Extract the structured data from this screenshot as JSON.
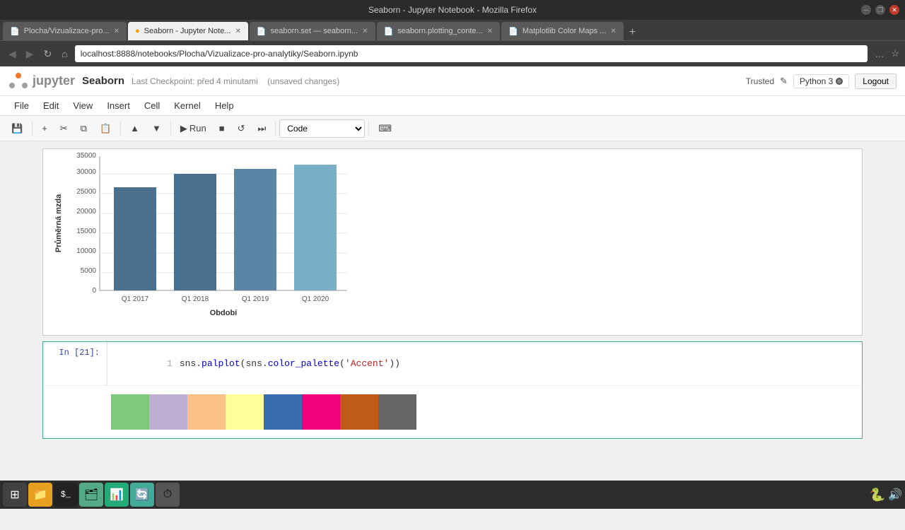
{
  "window": {
    "title": "Seaborn - Jupyter Notebook - Mozilla Firefox",
    "controls": [
      "minimize",
      "restore",
      "close"
    ]
  },
  "browser": {
    "nav_back": "◀",
    "nav_forward": "▶",
    "nav_refresh": "↻",
    "nav_home": "⌂",
    "address": "localhost:8888/notebooks/Plocha/Vizualizace-pro-analytiky/Seaborn.ipynb",
    "extra_btn": "…",
    "bookmark_icon": "☆"
  },
  "tabs": [
    {
      "label": "Plocha/Vizualizace-pro...",
      "active": false,
      "favicon": "📄"
    },
    {
      "label": "Seaborn - Jupyter Note...",
      "active": true,
      "favicon": "🟠"
    },
    {
      "label": "seaborn.set — seaborn...",
      "active": false,
      "favicon": "📄"
    },
    {
      "label": "seaborn.plotting_conte...",
      "active": false,
      "favicon": "📄"
    },
    {
      "label": "Matplotlib Color Maps ...",
      "active": false,
      "favicon": "📄"
    }
  ],
  "jupyter": {
    "logo_text": "jupyter",
    "notebook_title": "Seaborn",
    "checkpoint_text": "Last Checkpoint: před 4 minutami",
    "unsaved": "(unsaved changes)",
    "trusted": "Trusted",
    "edit_icon": "✎",
    "kernel": "Python 3",
    "logout": "Logout"
  },
  "menu": {
    "items": [
      "File",
      "Edit",
      "View",
      "Insert",
      "Cell",
      "Kernel",
      "Help"
    ]
  },
  "toolbar": {
    "save": "💾",
    "add": "+",
    "cut": "✂",
    "copy": "⧉",
    "paste": "📋",
    "move_up": "▲",
    "move_down": "▼",
    "run": "▶ Run",
    "stop": "■",
    "restart": "↺",
    "restart_run": "⏭",
    "cell_type": "Code",
    "keyboard": "⌨"
  },
  "chart": {
    "y_label": "Průměrná mzda",
    "x_label": "Období",
    "x_ticks": [
      "Q1 2017",
      "Q1 2018",
      "Q1 2019",
      "Q1 2020"
    ],
    "y_ticks": [
      "0",
      "5000",
      "10000",
      "15000",
      "20000",
      "25000",
      "30000",
      "35000"
    ],
    "bars": [
      {
        "label": "Q1 2017",
        "value": 27000,
        "color": "#4a7090"
      },
      {
        "label": "Q1 2018",
        "value": 30500,
        "color": "#4a7090"
      },
      {
        "label": "Q1 2019",
        "value": 31800,
        "color": "#5a85a5"
      },
      {
        "label": "Q1 2020",
        "value": 33000,
        "color": "#7aafc8"
      }
    ]
  },
  "code_cell": {
    "in_label": "In [21]:",
    "line_num": "1",
    "code_text": "sns.palplot(sns.color_palette('Accent'))",
    "code_fn": "sns.palplot",
    "code_inner_fn": "sns.color_palette",
    "code_str": "'Accent'"
  },
  "palette": {
    "swatches": [
      "#7fc97f",
      "#beaed4",
      "#fdc086",
      "#ffff99",
      "#386cb0",
      "#f0027f",
      "#bf5b17",
      "#666666"
    ]
  },
  "taskbar": {
    "apps": [
      {
        "name": "apps-grid",
        "icon": "⊞"
      },
      {
        "name": "files",
        "icon": "📁",
        "color": "#e8a020"
      },
      {
        "name": "terminal",
        "icon": "⬛",
        "color": "#333"
      },
      {
        "name": "files-manager",
        "icon": "🗂",
        "color": "#4a9"
      },
      {
        "name": "spreadsheet",
        "icon": "📊",
        "color": "#2a7"
      },
      {
        "name": "app6",
        "icon": "🔄",
        "color": "#2a8"
      },
      {
        "name": "app7",
        "icon": "⏱",
        "color": "#666"
      }
    ],
    "right": {
      "python_icon": "🐍",
      "speaker": "🔊"
    }
  }
}
